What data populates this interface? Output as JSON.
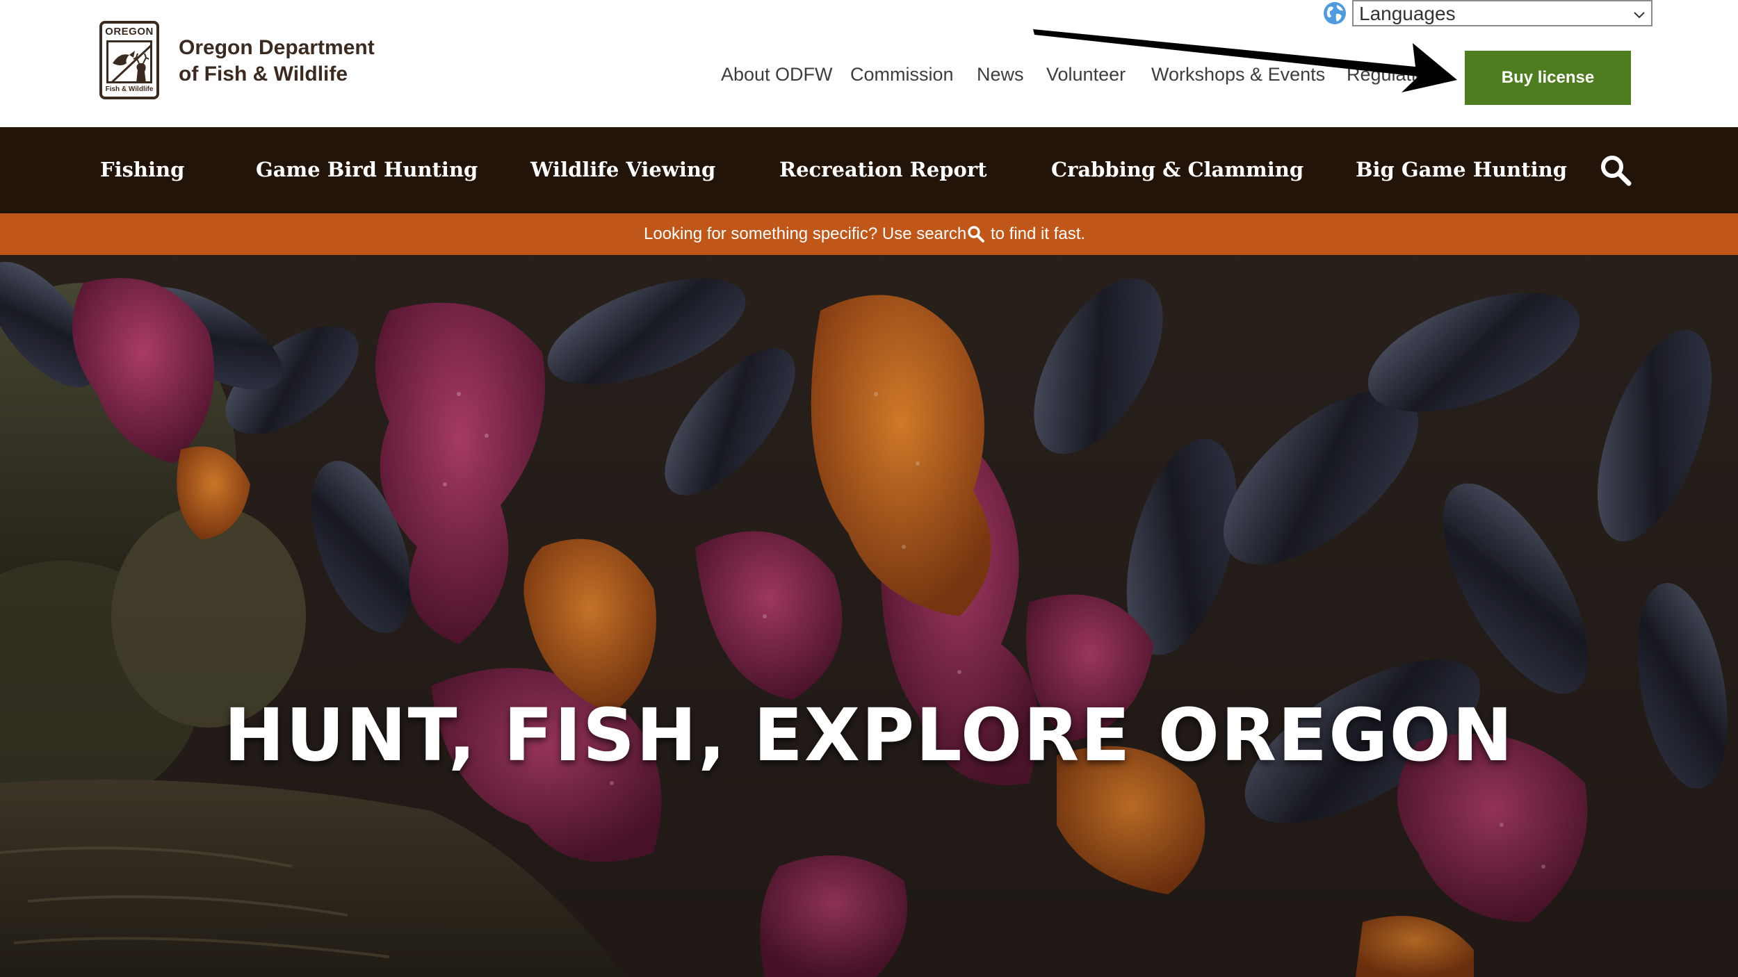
{
  "logo": {
    "top_text": "OREGON",
    "bottom_text": "Fish & Wildlife"
  },
  "org_name": {
    "line1": "Oregon Department",
    "line2": "of Fish & Wildlife"
  },
  "language_select": {
    "value": "Languages",
    "icon": "globe-icon"
  },
  "utility_nav": [
    {
      "label": "About ODFW"
    },
    {
      "label": "Commission"
    },
    {
      "label": "News"
    },
    {
      "label": "Volunteer"
    },
    {
      "label": "Workshops & Events"
    },
    {
      "label": "Regulations"
    }
  ],
  "buy_button": {
    "label": "Buy license",
    "color": "#4d7d1f"
  },
  "main_nav": [
    {
      "label": "Fishing"
    },
    {
      "label": "Game Bird Hunting"
    },
    {
      "label": "Wildlife Viewing"
    },
    {
      "label": "Recreation Report"
    },
    {
      "label": "Crabbing & Clamming"
    },
    {
      "label": "Big Game Hunting"
    }
  ],
  "notice": {
    "before": "Looking for something specific? Use search",
    "after": "to find it fast."
  },
  "hero": {
    "title": "HUNT, FISH, EXPLORE OREGON"
  },
  "colors": {
    "brand_brown": "#3b2a1f",
    "nav_background": "#231409",
    "notice_background": "#c05618",
    "button_green": "#4d7d1f"
  }
}
